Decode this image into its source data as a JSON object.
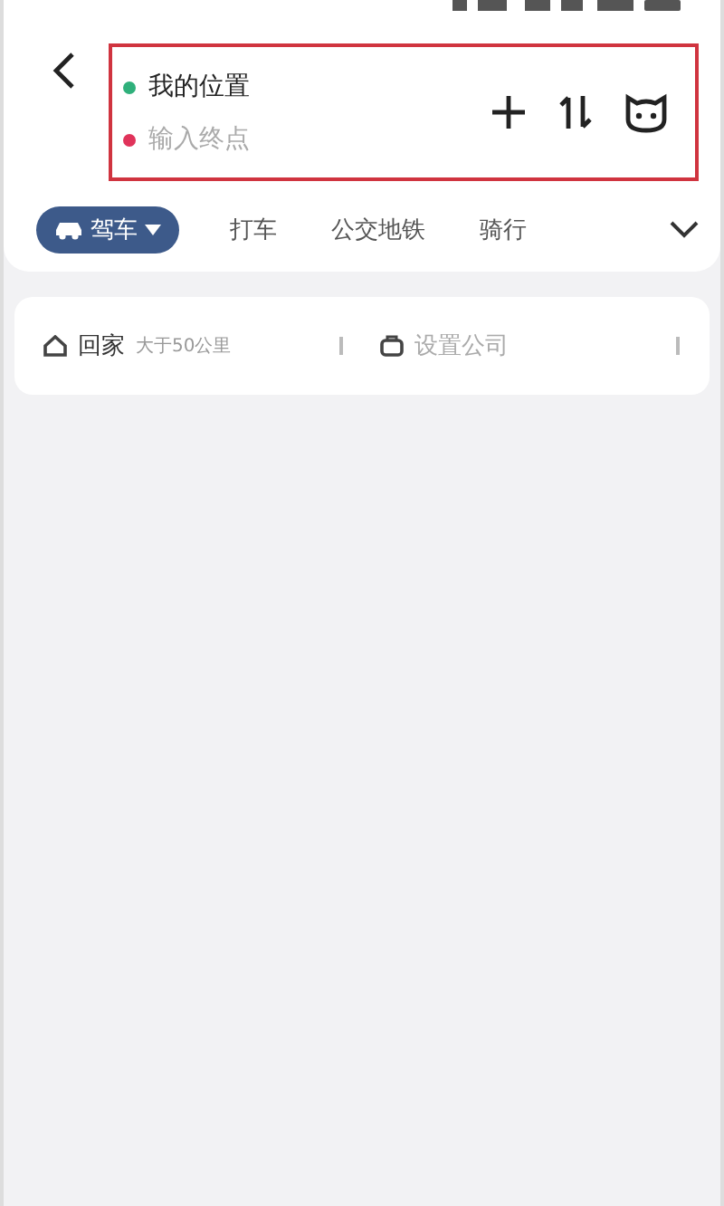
{
  "route": {
    "start": "我的位置",
    "end_placeholder": "输入终点",
    "highlighted": true
  },
  "modes": [
    {
      "label": "驾车",
      "selected": true
    },
    {
      "label": "打车",
      "selected": false
    },
    {
      "label": "公交地铁",
      "selected": false
    },
    {
      "label": "骑行",
      "selected": false
    }
  ],
  "shortcuts": [
    {
      "kind": "home",
      "label": "回家",
      "note": "大于50公里",
      "set": true
    },
    {
      "kind": "work",
      "label": "设置公司",
      "set": false
    }
  ]
}
